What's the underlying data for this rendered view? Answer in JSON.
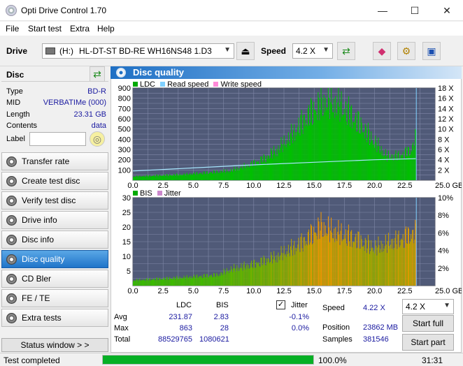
{
  "window": {
    "title": "Opti Drive Control 1.70",
    "min": "—",
    "max": "☐",
    "close": "✕"
  },
  "menu": [
    "File",
    "Start test",
    "Extra",
    "Help"
  ],
  "toolbar": {
    "drive_label": "Drive",
    "drive_letter": "(H:)",
    "drive_name": "HL-DT-ST BD-RE  WH16NS48 1.D3",
    "speed_label": "Speed",
    "speed_value": "4.2 X"
  },
  "disc": {
    "header": "Disc",
    "rows": [
      {
        "k": "Type",
        "v": "BD-R"
      },
      {
        "k": "MID",
        "v": "VERBATIMe (000)"
      },
      {
        "k": "Length",
        "v": "23.31 GB"
      },
      {
        "k": "Contents",
        "v": "data"
      }
    ],
    "label_key": "Label",
    "label_value": ""
  },
  "nav": [
    "Transfer rate",
    "Create test disc",
    "Verify test disc",
    "Drive info",
    "Disc info",
    "Disc quality",
    "CD Bler",
    "FE / TE",
    "Extra tests"
  ],
  "nav_active": "Disc quality",
  "status_window_btn": "Status window > >",
  "dq": {
    "title": "Disc quality",
    "legend_top": [
      "LDC",
      "Read speed",
      "Write speed"
    ],
    "legend_bottom": [
      "BIS",
      "Jitter"
    ],
    "colors": {
      "ldc": "#00aa00",
      "read": "#7fd0ff",
      "write": "#ff8ad8",
      "bis": "#00aa00",
      "jitter": "#cc88cc",
      "plotbg": "#505a78"
    }
  },
  "chart_data": [
    {
      "type": "area",
      "title": "",
      "series": [
        {
          "name": "LDC"
        },
        {
          "name": "Read speed"
        }
      ],
      "x_ticks": [
        "0.0",
        "2.5",
        "5.0",
        "7.5",
        "10.0",
        "12.5",
        "15.0",
        "17.5",
        "20.0",
        "22.5",
        "25.0 GB"
      ],
      "y_left_ticks": [
        "900",
        "800",
        "700",
        "600",
        "500",
        "400",
        "300",
        "200",
        "100"
      ],
      "y_right_ticks": [
        "18 X",
        "16 X",
        "14 X",
        "12 X",
        "10 X",
        "8 X",
        "6 X",
        "4 X",
        "2 X"
      ],
      "xlim": [
        0,
        25
      ],
      "ylim": [
        0,
        900
      ],
      "ldc_profile": [
        [
          0,
          40
        ],
        [
          2,
          50
        ],
        [
          4,
          60
        ],
        [
          6,
          80
        ],
        [
          8,
          100
        ],
        [
          9,
          140
        ],
        [
          10,
          180
        ],
        [
          11,
          240
        ],
        [
          12,
          330
        ],
        [
          13,
          460
        ],
        [
          14,
          620
        ],
        [
          15,
          760
        ],
        [
          16,
          840
        ],
        [
          17,
          800
        ],
        [
          18,
          700
        ],
        [
          19,
          560
        ],
        [
          20,
          400
        ],
        [
          21,
          250
        ],
        [
          22,
          260
        ],
        [
          23,
          320
        ],
        [
          23.5,
          500
        ]
      ],
      "read_speed": [
        [
          0,
          1.8
        ],
        [
          5,
          2.4
        ],
        [
          10,
          3.0
        ],
        [
          15,
          3.5
        ],
        [
          20,
          4.0
        ],
        [
          23.4,
          4.2
        ]
      ]
    },
    {
      "type": "area",
      "title": "",
      "series": [
        {
          "name": "BIS"
        },
        {
          "name": "Jitter"
        }
      ],
      "x_ticks": [
        "0.0",
        "2.5",
        "5.0",
        "7.5",
        "10.0",
        "12.5",
        "15.0",
        "17.5",
        "20.0",
        "22.5",
        "25.0 GB"
      ],
      "y_left_ticks": [
        "30",
        "25",
        "20",
        "15",
        "10",
        "5"
      ],
      "y_right_ticks": [
        "10%",
        "8%",
        "6%",
        "4%",
        "2%"
      ],
      "xlim": [
        0,
        25
      ],
      "ylim": [
        0,
        30
      ],
      "bis_profile": [
        [
          0,
          2
        ],
        [
          4,
          3
        ],
        [
          7,
          4
        ],
        [
          8,
          6
        ],
        [
          10,
          8
        ],
        [
          12,
          11
        ],
        [
          14,
          16
        ],
        [
          15.5,
          22
        ],
        [
          16.5,
          20
        ],
        [
          18,
          18
        ],
        [
          20,
          14
        ],
        [
          22,
          17
        ],
        [
          23.4,
          20
        ]
      ]
    }
  ],
  "stats": {
    "col_ldc": "LDC",
    "col_bis": "BIS",
    "jitter_label": "Jitter",
    "jitter_checked": "✓",
    "rows": [
      {
        "k": "Avg",
        "ldc": "231.87",
        "bis": "2.83",
        "jit": "-0.1%"
      },
      {
        "k": "Max",
        "ldc": "863",
        "bis": "28",
        "jit": "0.0%"
      },
      {
        "k": "Total",
        "ldc": "88529765",
        "bis": "1080621",
        "jit": ""
      }
    ],
    "speed_label": "Speed",
    "speed_value": "4.22 X",
    "speed_select": "4.2 X",
    "position_label": "Position",
    "position_value": "23862 MB",
    "samples_label": "Samples",
    "samples_value": "381546",
    "start_full": "Start full",
    "start_part": "Start part"
  },
  "status": {
    "text": "Test completed",
    "progress": 1.0,
    "percent": "100.0%",
    "time": "31:31"
  }
}
